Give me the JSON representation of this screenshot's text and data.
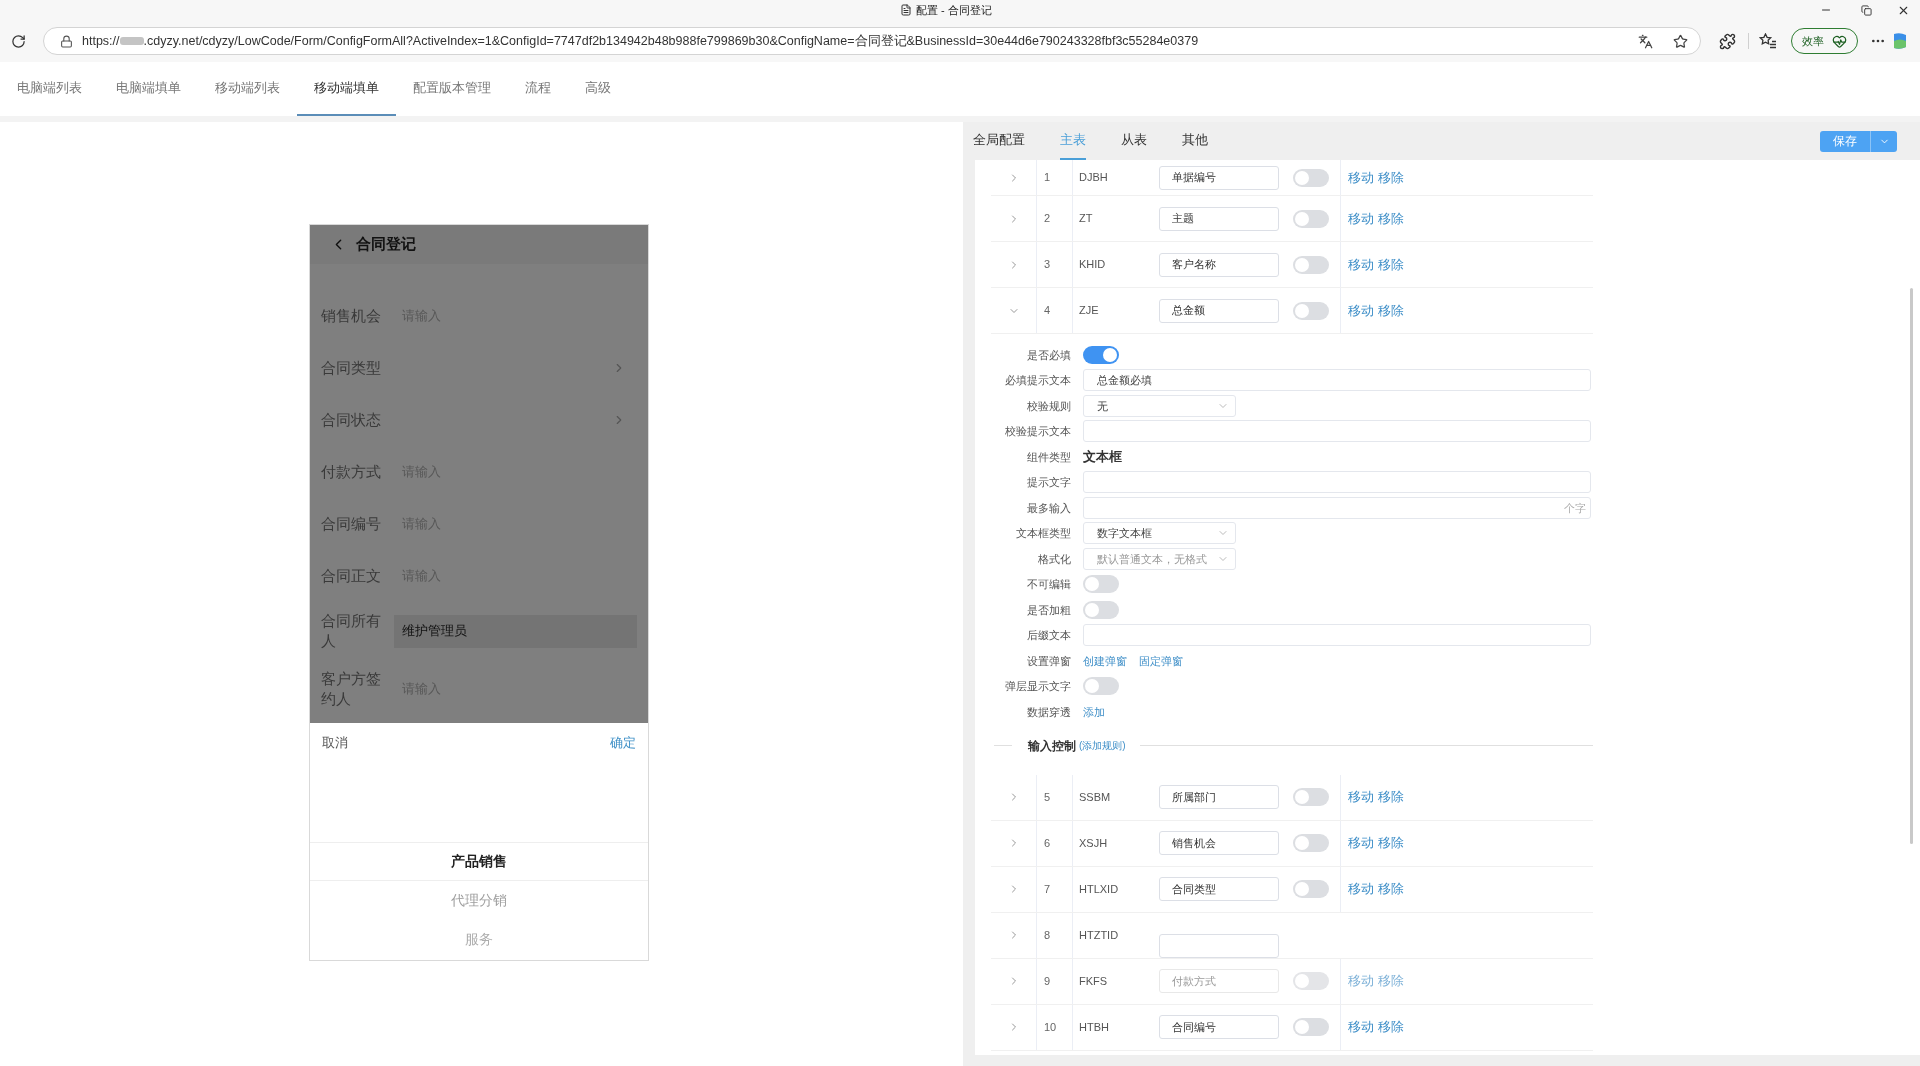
{
  "browser": {
    "tab_title": "配置 - 合同登记",
    "url_prefix": "https://",
    "url": ".cdyzy.net/cdyzy/LowCode/Form/ConfigFormAll?ActiveIndex=1&ConfigId=7747df2b134942b48b988fe799869b30&ConfigName=合同登记&BusinessId=30e44d6e790243328fbf3c55284e0379",
    "essentials_label": "效率"
  },
  "nav_tabs": [
    {
      "label": "电脑端列表",
      "selected": false
    },
    {
      "label": "电脑端填单",
      "selected": false
    },
    {
      "label": "移动端列表",
      "selected": false
    },
    {
      "label": "移动端填单",
      "selected": true
    },
    {
      "label": "配置版本管理",
      "selected": false
    },
    {
      "label": "流程",
      "selected": false
    },
    {
      "label": "高级",
      "selected": false
    }
  ],
  "preview": {
    "title": "合同登记",
    "fields": [
      {
        "label": "销售机会",
        "kind": "input",
        "placeholder": "请输入"
      },
      {
        "label": "合同类型",
        "kind": "select"
      },
      {
        "label": "合同状态",
        "kind": "select"
      },
      {
        "label": "付款方式",
        "kind": "input",
        "placeholder": "请输入"
      },
      {
        "label": "合同编号",
        "kind": "input",
        "placeholder": "请输入"
      },
      {
        "label": "合同正文",
        "kind": "input",
        "placeholder": "请输入"
      },
      {
        "label": "合同所有人",
        "kind": "readonly",
        "value": "维护管理员"
      },
      {
        "label": "客户方签约人",
        "kind": "input",
        "placeholder": "请输入"
      }
    ],
    "sheet": {
      "cancel": "取消",
      "confirm": "确定",
      "options": [
        {
          "label": "产品销售",
          "selected": true
        },
        {
          "label": "代理分销",
          "selected": false
        },
        {
          "label": "服务",
          "selected": false
        }
      ]
    }
  },
  "config": {
    "tabs": [
      {
        "label": "全局配置",
        "selected": false
      },
      {
        "label": "主表",
        "selected": true
      },
      {
        "label": "从表",
        "selected": false
      },
      {
        "label": "其他",
        "selected": false
      }
    ],
    "save_label": "保存",
    "rows": [
      {
        "expanded": false,
        "dimmed": false,
        "index": "1",
        "code": "DJBH",
        "title": "单据编号",
        "on": false,
        "actions": [
          "移动",
          "移除"
        ]
      },
      {
        "expanded": false,
        "dimmed": false,
        "index": "2",
        "code": "ZT",
        "title": "主题",
        "on": false,
        "actions": [
          "移动",
          "移除"
        ]
      },
      {
        "expanded": false,
        "dimmed": false,
        "index": "3",
        "code": "KHID",
        "title": "客户名称",
        "on": false,
        "actions": [
          "移动",
          "移除"
        ]
      },
      {
        "expanded": true,
        "dimmed": false,
        "index": "4",
        "code": "ZJE",
        "title": "总金额",
        "on": false,
        "actions": [
          "移动",
          "移除"
        ],
        "details": [
          {
            "kind": "toggle",
            "label": "是否必填",
            "on": true
          },
          {
            "kind": "input",
            "label": "必填提示文本",
            "value": "总金额必填"
          },
          {
            "kind": "select",
            "label": "校验规则",
            "value": "无"
          },
          {
            "kind": "input",
            "label": "校验提示文本"
          },
          {
            "kind": "text",
            "label": "组件类型",
            "value": "文本框"
          },
          {
            "kind": "input",
            "label": "提示文字"
          },
          {
            "kind": "input",
            "label": "最多输入",
            "suffix": "个字"
          },
          {
            "kind": "select",
            "label": "文本框类型",
            "value": "数字文本框"
          },
          {
            "kind": "select",
            "label": "格式化",
            "placeholder": "默认普通文本，无格式"
          },
          {
            "kind": "toggle",
            "label": "不可编辑",
            "on": false
          },
          {
            "kind": "toggle",
            "label": "是否加粗",
            "on": false
          },
          {
            "kind": "input",
            "label": "后缀文本"
          },
          {
            "kind": "links",
            "label": "设置弹窗",
            "links": [
              "创建弹窗",
              "固定弹窗"
            ]
          },
          {
            "kind": "toggle",
            "label": "弹层显示文字",
            "on": false
          },
          {
            "kind": "links",
            "label": "数据穿透",
            "links": [
              "添加"
            ]
          }
        ],
        "input_control": {
          "title": "输入控制",
          "link": "(添加规则)"
        }
      },
      {
        "expanded": false,
        "dimmed": false,
        "index": "5",
        "code": "SSBM",
        "title": "所属部门",
        "on": false,
        "actions": [
          "移动",
          "移除"
        ]
      },
      {
        "expanded": false,
        "dimmed": false,
        "index": "6",
        "code": "XSJH",
        "title": "销售机会",
        "on": false,
        "actions": [
          "移动",
          "移除"
        ]
      },
      {
        "expanded": false,
        "dimmed": false,
        "index": "7",
        "code": "HTLXID",
        "title": "合同类型",
        "on": false,
        "actions": [
          "移动",
          "移除"
        ]
      },
      {
        "expanded": false,
        "dimmed": false,
        "index": "8",
        "code": "HTZTID"
      },
      {
        "expanded": false,
        "dimmed": true,
        "index": "9",
        "code": "FKFS",
        "title": "付款方式",
        "on": false,
        "actions": [
          "移动",
          "移除"
        ]
      },
      {
        "expanded": false,
        "dimmed": false,
        "index": "10",
        "code": "HTBH",
        "title": "合同编号",
        "on": false,
        "actions": [
          "移动",
          "移除"
        ]
      }
    ]
  }
}
